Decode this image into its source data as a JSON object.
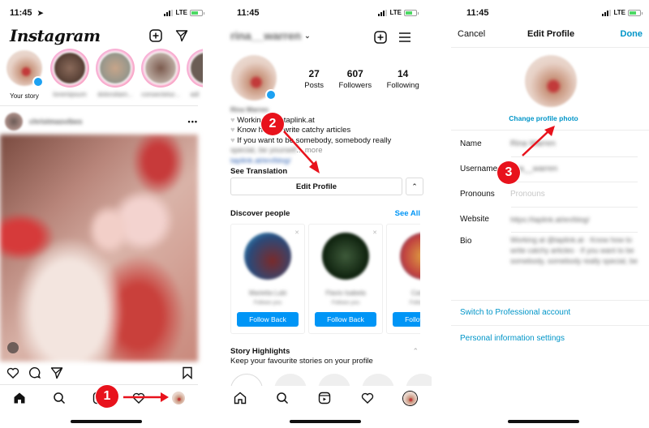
{
  "panels": [
    {
      "status": {
        "time": "11:45",
        "network": "LTE"
      },
      "header": {
        "logo": "Instagram",
        "new_post_icon": "plus-square-icon",
        "direct_icon": "paper-plane-icon"
      },
      "stories": [
        {
          "label": "Your story"
        },
        {
          "label": "loremipsum"
        },
        {
          "label": "dolorsitam..."
        },
        {
          "label": "consectetur..."
        },
        {
          "label": "adi"
        }
      ],
      "post": {
        "username": "christmasvibes",
        "more": "•••"
      },
      "step_badge": "1"
    },
    {
      "status": {
        "time": "11:45",
        "network": "LTE"
      },
      "header": {
        "username": "rina__warren"
      },
      "stats": [
        {
          "value": "27",
          "label": "Posts"
        },
        {
          "value": "607",
          "label": "Followers"
        },
        {
          "value": "14",
          "label": "Following"
        }
      ],
      "bio": {
        "name": "Rina Warren",
        "lines": [
          "Working at @taplink.at",
          "Know how to write catchy articles",
          "If you want to be somebody, somebody really"
        ],
        "line4_blur": "special, be yourself",
        "more": "... more",
        "link": "taplink.at/en/blog/",
        "see_translation": "See Translation"
      },
      "edit_profile": "Edit Profile",
      "discover": {
        "title": "Discover people",
        "see_all": "See All",
        "cards": [
          {
            "name": "Marietta Lubi",
            "sub": "Follows you",
            "button": "Follow Back"
          },
          {
            "name": "Flavio Isabela",
            "sub": "Follows you",
            "button": "Follow Back"
          },
          {
            "name": "Carmine",
            "sub": "Follows you",
            "button": "Follow Back"
          }
        ]
      },
      "highlights": {
        "title": "Story Highlights",
        "subtitle": "Keep your favourite stories on your profile"
      },
      "step_badge": "2"
    },
    {
      "status": {
        "time": "11:45",
        "network": "LTE"
      },
      "nav": {
        "cancel": "Cancel",
        "title": "Edit Profile",
        "done": "Done"
      },
      "change_photo": "Change profile photo",
      "fields": [
        {
          "label": "Name",
          "value": "Rina Warren",
          "placeholder": ""
        },
        {
          "label": "Username",
          "value": "rina__warren",
          "placeholder": ""
        },
        {
          "label": "Pronouns",
          "value": "",
          "placeholder": "Pronouns"
        },
        {
          "label": "Website",
          "value": "https://taplink.at/en/blog/",
          "placeholder": ""
        },
        {
          "label": "Bio",
          "value": "Working at @taplink.at · Know how to write catchy articles · If you want to be somebody, somebody really special, be",
          "placeholder": ""
        }
      ],
      "links": [
        "Switch to Professional account",
        "Personal information settings"
      ],
      "step_badge": "3"
    }
  ],
  "colors": {
    "accent_blue": "#0095f6",
    "link_blue": "#0095c8",
    "badge_red": "#e8121c"
  }
}
